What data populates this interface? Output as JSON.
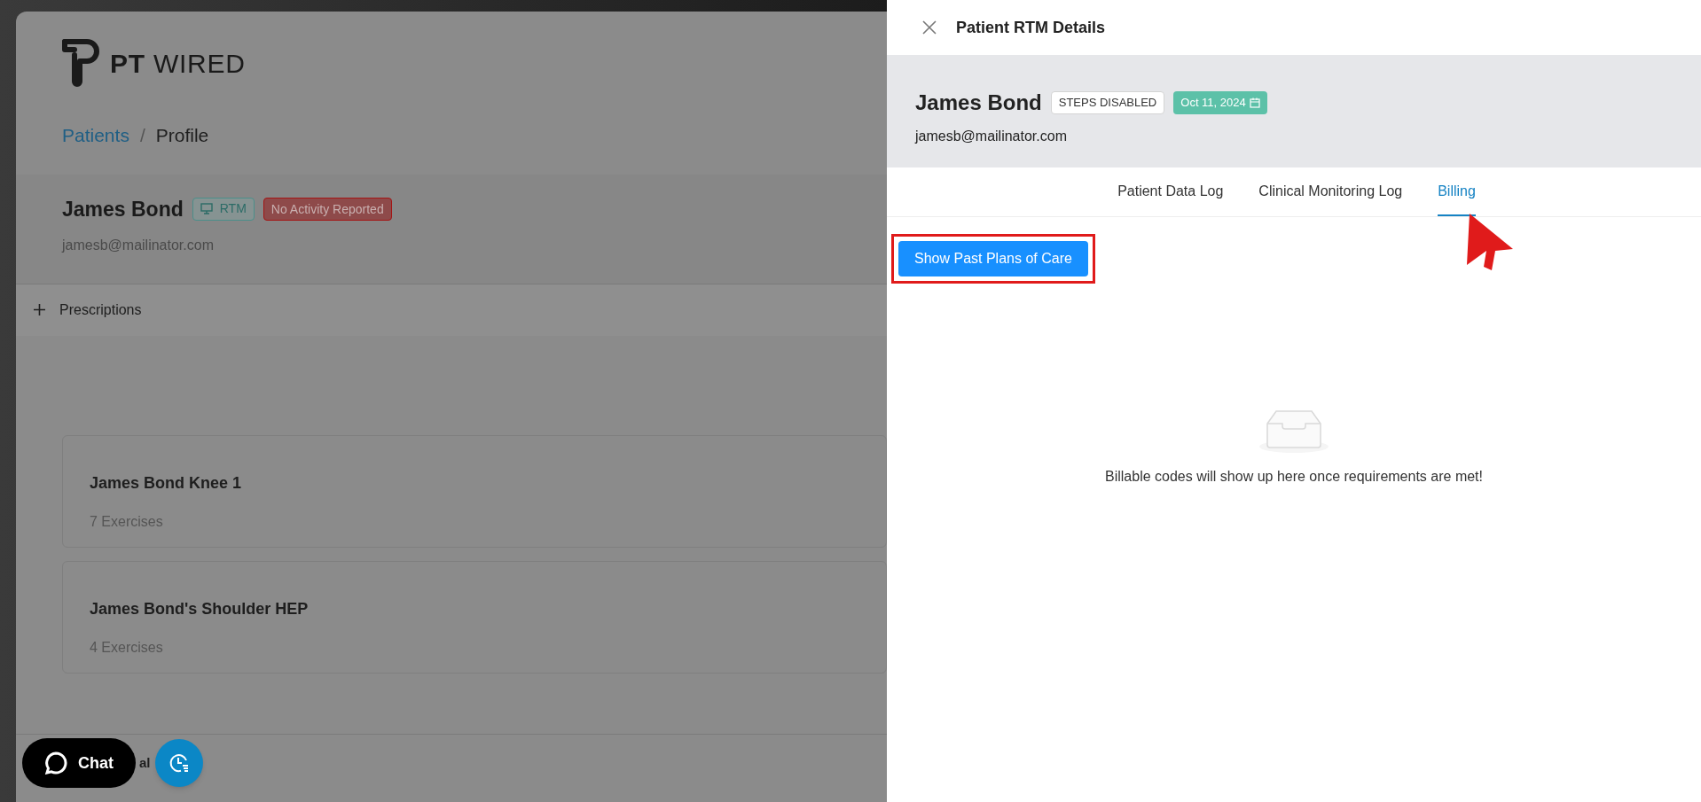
{
  "page": {
    "logo": "**PT** WIRED",
    "breadcrumb": [
      {
        "label": "Patients",
        "kind": "link"
      },
      {
        "label": "Profile",
        "kind": "current"
      }
    ],
    "breadcrumb_separator": "/",
    "patient": {
      "name": "James Bond",
      "badges": [
        {
          "label": "RTM",
          "kind": "rtm"
        },
        {
          "label": "No Activity Reported",
          "kind": "alert"
        }
      ],
      "email": "jamesb@mailinator.com"
    },
    "section": {
      "label": "Prescriptions",
      "expanded": false
    },
    "programs": [
      {
        "title": "James Bond Knee 1",
        "subtitle": "7 Exercises"
      },
      {
        "title": "James Bond's Shoulder HEP",
        "subtitle": "4 Exercises"
      }
    ],
    "next_section_label": "al",
    "chat_button": "Chat"
  },
  "drawer": {
    "title": "Patient RTM Details",
    "patient": {
      "name": "James Bond",
      "badges": [
        {
          "label": "STEPS DISABLED",
          "kind": "status"
        },
        {
          "label": "Oct 11, 2024",
          "kind": "date"
        }
      ],
      "email": "jamesb@mailinator.com"
    },
    "tabs": [
      {
        "label": "Patient Data Log",
        "selected": false
      },
      {
        "label": "Clinical Monitoring Log",
        "selected": false
      },
      {
        "label": "Billing",
        "selected": true
      }
    ],
    "button": "Show Past Plans of Care",
    "empty_text": "Billable codes will show up here once requirements are met!"
  }
}
